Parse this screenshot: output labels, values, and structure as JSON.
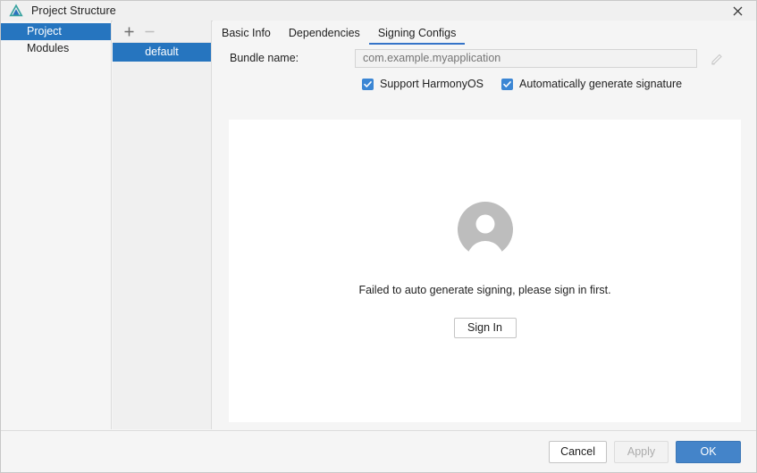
{
  "window": {
    "title": "Project Structure",
    "logo_icon": "deveco-triangle-logo",
    "close_icon": "close-x-icon"
  },
  "sidebar": {
    "items": [
      {
        "label": "Project",
        "selected": true
      },
      {
        "label": "Modules",
        "selected": false
      }
    ]
  },
  "config_list": {
    "toolbar": {
      "add_icon": "plus-icon",
      "remove_icon": "minus-icon",
      "add_enabled": true,
      "remove_enabled": false
    },
    "items": [
      {
        "label": "default",
        "selected": true
      }
    ]
  },
  "tabs": [
    {
      "label": "Basic Info",
      "active": false
    },
    {
      "label": "Dependencies",
      "active": false
    },
    {
      "label": "Signing Configs",
      "active": true
    }
  ],
  "form": {
    "bundle_name": {
      "label": "Bundle name:",
      "value": "",
      "placeholder": "com.example.myapplication",
      "edit_icon": "pencil-edit-icon"
    },
    "checkboxes": [
      {
        "label": "Support HarmonyOS",
        "checked": true
      },
      {
        "label": "Automatically generate signature",
        "checked": true
      }
    ]
  },
  "content": {
    "avatar_icon": "user-avatar-icon",
    "message": "Failed to auto generate signing, please sign in first.",
    "sign_in_label": "Sign In"
  },
  "footer": {
    "cancel_label": "Cancel",
    "apply_label": "Apply",
    "ok_label": "OK",
    "apply_enabled": false
  },
  "colors": {
    "accent_blue": "#2675bf",
    "tab_underline": "#3574c8",
    "checkbox_blue": "#3b86d4",
    "ok_button": "#4484c9",
    "window_bg": "#f5f5f5",
    "card_bg": "#ffffff"
  }
}
